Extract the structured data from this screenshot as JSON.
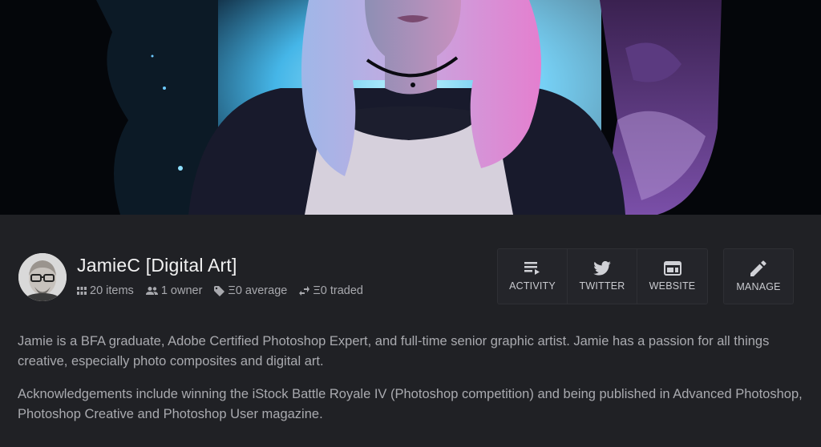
{
  "profile": {
    "name": "JamieC [Digital Art]",
    "stats": {
      "items": "20 items",
      "owners": "1 owner",
      "average": "Ξ0 average",
      "traded": "Ξ0 traded"
    }
  },
  "actions": {
    "activity": "ACTIVITY",
    "twitter": "TWITTER",
    "website": "WEBSITE",
    "manage": "MANAGE"
  },
  "bio": {
    "paragraph1": "Jamie is a BFA graduate, Adobe Certified Photoshop Expert, and full-time senior graphic artist. Jamie has a passion for all things creative, especially photo composites and digital art.",
    "paragraph2": "Acknowledgements include winning the iStock Battle Royale IV (Photoshop competition) and being published in Advanced Photoshop, Photoshop Creative and Photoshop User magazine."
  },
  "icons": {
    "items": "grid-icon",
    "owners": "people-icon",
    "average": "tag-icon",
    "traded": "swap-icon",
    "activity": "list-icon",
    "twitter": "twitter-bird-icon",
    "website": "browser-window-icon",
    "manage": "pencil-icon"
  },
  "colors": {
    "background": "#202125",
    "text": "#e6e6e6",
    "muted": "#a8a9ae",
    "banner_pink": "#d77fd0",
    "banner_cyan": "#6fd4ff"
  }
}
